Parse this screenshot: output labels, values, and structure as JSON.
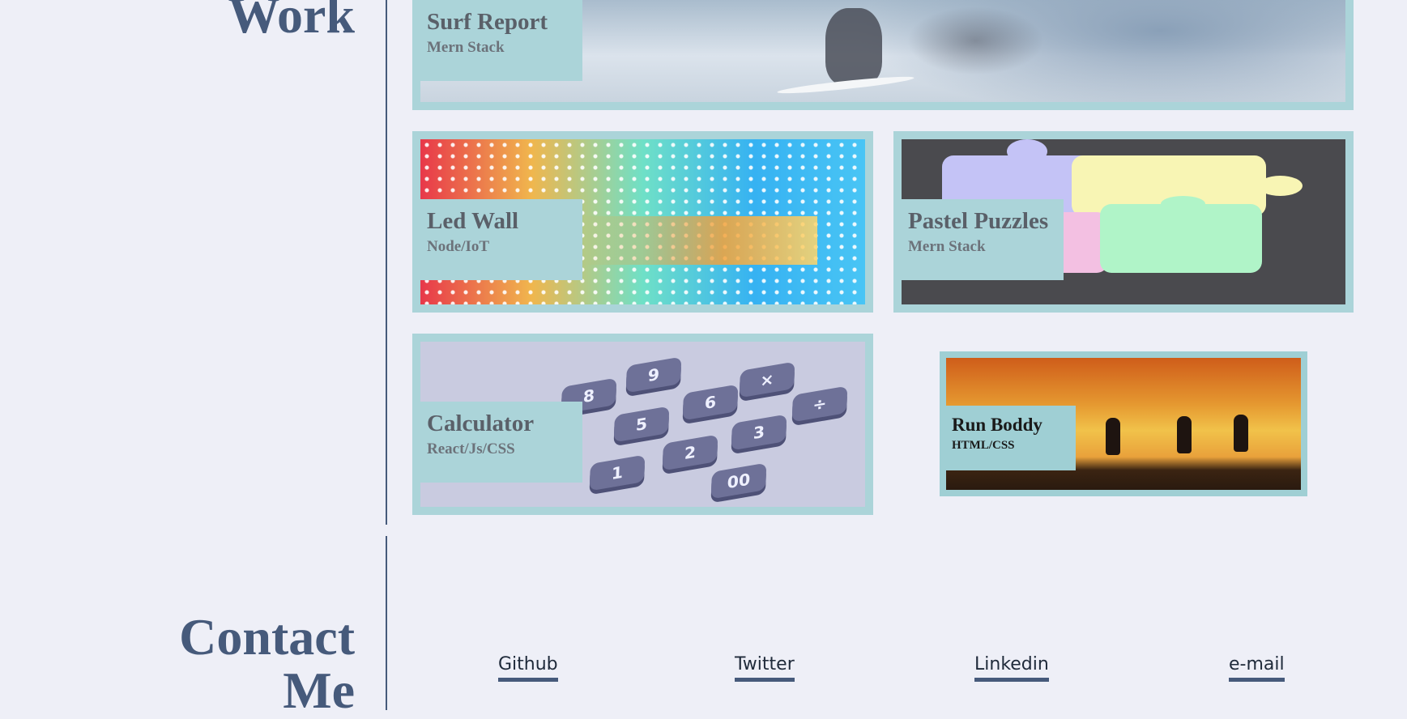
{
  "sections": {
    "work_title": "Work",
    "contact_title_line1": "Contact",
    "contact_title_line2": "Me"
  },
  "projects": [
    {
      "name": "Surf Report",
      "stack": "Mern Stack",
      "image": "surfer-photo"
    },
    {
      "name": "Led Wall",
      "stack": "Node/IoT",
      "image": "led-wall-photo"
    },
    {
      "name": "Pastel Puzzles",
      "stack": "Mern Stack",
      "image": "puzzle-pieces-photo"
    },
    {
      "name": "Calculator",
      "stack": "React/Js/CSS",
      "image": "calculator-keys-photo"
    },
    {
      "name": "Run Boddy",
      "stack": "HTML/CSS",
      "image": "runners-sunset-photo"
    }
  ],
  "calculator_keys": [
    "9",
    "8",
    "6",
    "5",
    "3",
    "2",
    "1",
    "00",
    "×",
    "÷"
  ],
  "contact_links": [
    {
      "label": "Github"
    },
    {
      "label": "Twitter"
    },
    {
      "label": "Linkedin"
    },
    {
      "label": "e-mail"
    }
  ],
  "colors": {
    "background": "#eeeff7",
    "heading": "#465a7b",
    "card_frame": "#abd4d9",
    "link_underline": "#465a7b"
  }
}
